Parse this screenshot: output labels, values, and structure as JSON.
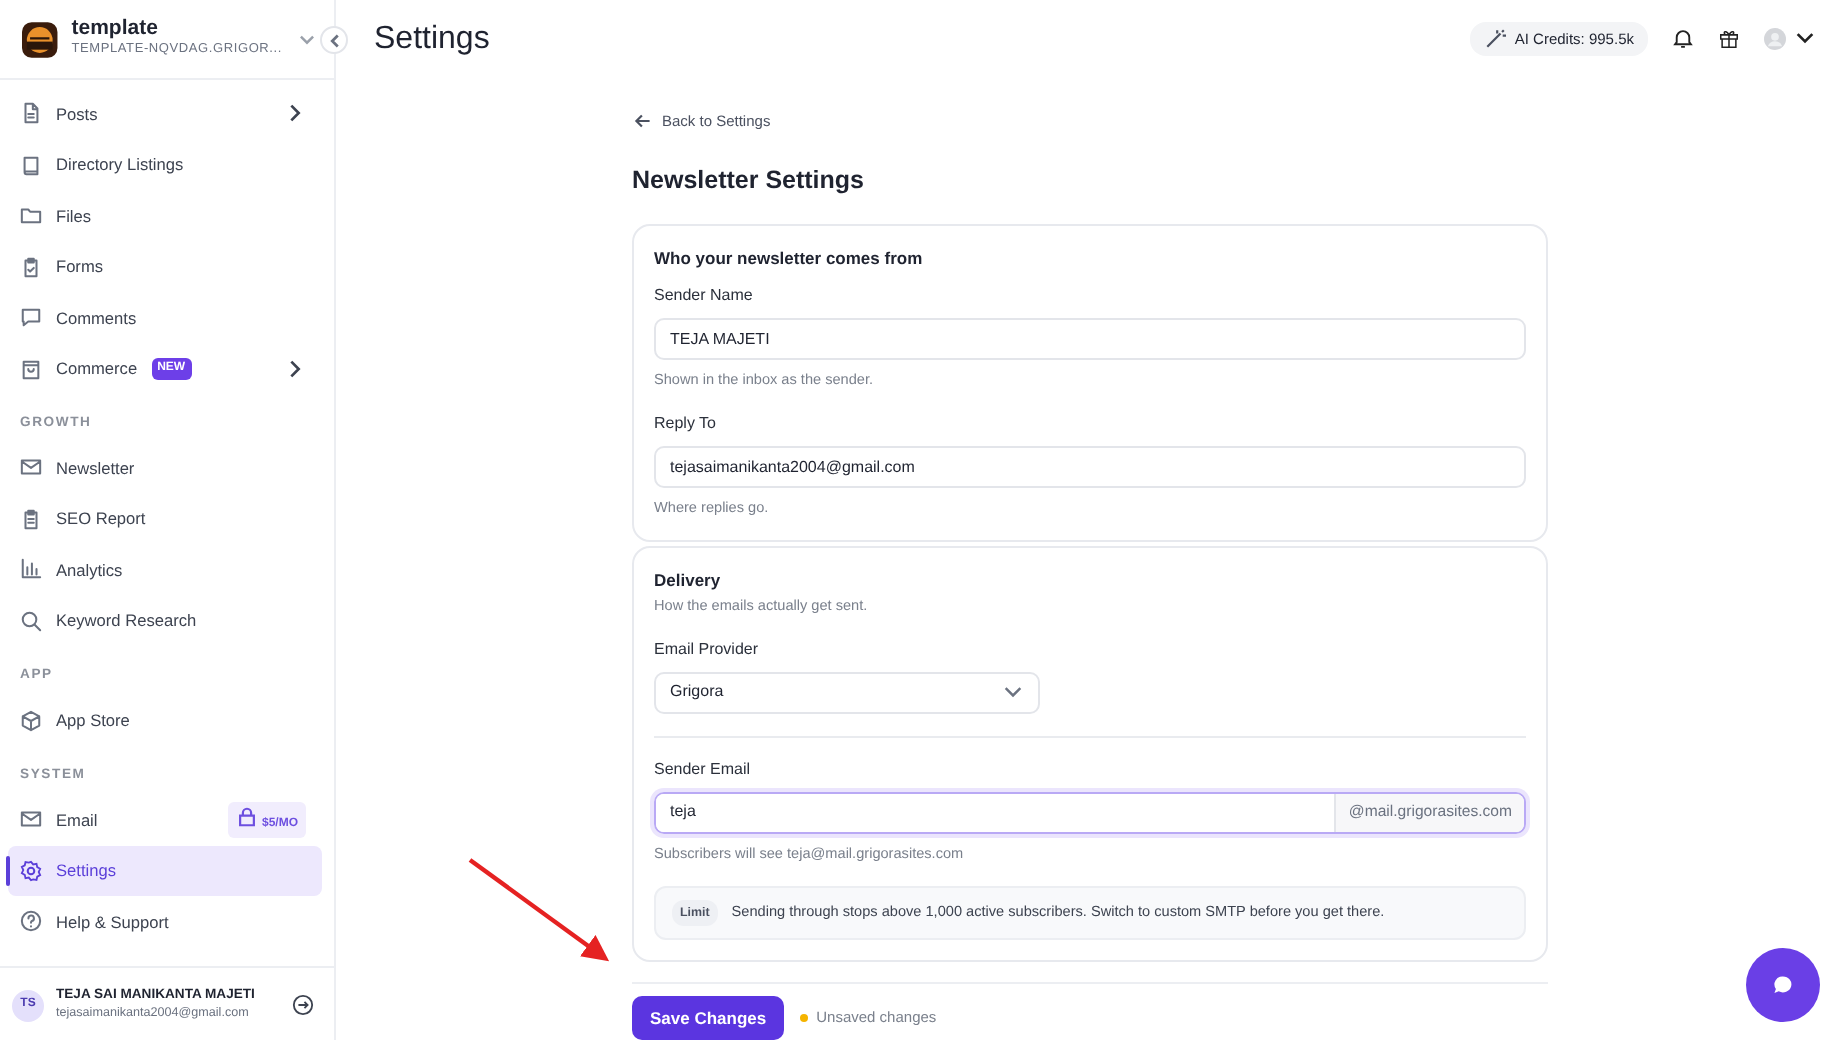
{
  "workspace": {
    "name": "template",
    "domain": "TEMPLATE-NQVDAG.GRIGOR..."
  },
  "sidebar": {
    "sections": [
      {
        "items": [
          {
            "label": "Posts",
            "expandable": true,
            "selected": false
          },
          {
            "label": "Directory Listings",
            "expandable": false,
            "selected": false
          },
          {
            "label": "Files",
            "expandable": false,
            "selected": false
          },
          {
            "label": "Forms",
            "expandable": false,
            "selected": false
          },
          {
            "label": "Comments",
            "expandable": false,
            "selected": false
          },
          {
            "label": "Commerce",
            "badge": "NEW",
            "expandable": true,
            "selected": false
          }
        ]
      },
      {
        "heading": "GROWTH",
        "items": [
          {
            "label": "Newsletter",
            "expandable": false,
            "selected": false
          },
          {
            "label": "SEO Report",
            "expandable": false,
            "selected": false
          },
          {
            "label": "Analytics",
            "expandable": false,
            "selected": false
          },
          {
            "label": "Keyword Research",
            "expandable": false,
            "selected": false
          }
        ]
      },
      {
        "heading": "APP",
        "items": [
          {
            "label": "App Store",
            "expandable": false,
            "selected": false
          }
        ]
      },
      {
        "heading": "SYSTEM",
        "items": [
          {
            "label": "Email",
            "price": "$5/MO",
            "expandable": false,
            "selected": false
          },
          {
            "label": "Settings",
            "expandable": false,
            "selected": true
          },
          {
            "label": "Help & Support",
            "expandable": false,
            "selected": false
          }
        ]
      }
    ]
  },
  "user": {
    "initials": "TS",
    "name": "TEJA SAI MANIKANTA MAJETI",
    "email": "tejasaimanikanta2004@gmail.com"
  },
  "header": {
    "title": "Settings",
    "credits": "AI Credits: 995.5k"
  },
  "back_link": "Back to Settings",
  "page_title": "Newsletter Settings",
  "sender_card": {
    "title": "Who your newsletter comes from",
    "fields": [
      {
        "label": "Sender Name",
        "value": "TEJA MAJETI",
        "help": "Shown in the inbox as the sender."
      },
      {
        "label": "Reply To",
        "value": "tejasaimanikanta2004@gmail.com",
        "help": "Where replies go."
      }
    ]
  },
  "delivery_card": {
    "title": "Delivery",
    "subtitle": "How the emails actually get sent.",
    "provider": {
      "label": "Email Provider",
      "value": "Grigora"
    },
    "sender_email": {
      "label": "Sender Email",
      "value": "teja",
      "suffix": "@mail.grigorasites.com",
      "focused": true,
      "help": "Subscribers will see teja@mail.grigorasites.com"
    },
    "notice": {
      "tag": "Limit",
      "text": "Sending through stops above 1,000 active subscribers. Switch to custom SMTP before you get there."
    }
  },
  "save_button": "Save Changes",
  "unsaved_status": "Unsaved changes"
}
